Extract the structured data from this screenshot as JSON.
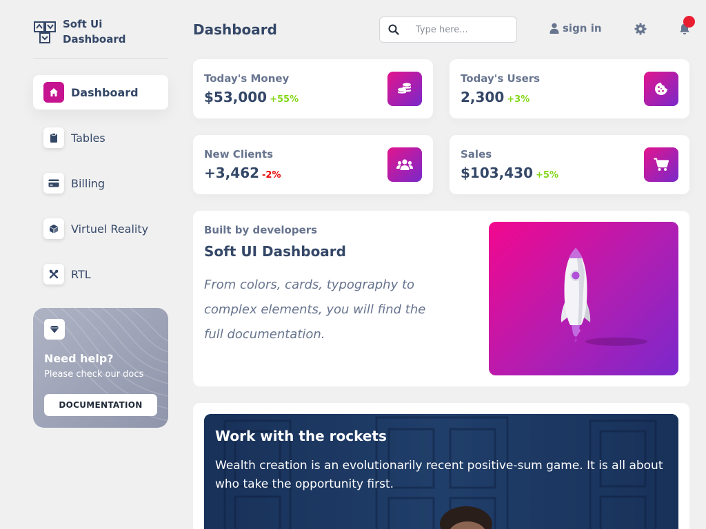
{
  "brand": {
    "name_line1": "Soft Ui",
    "name_line2": "Dashboard"
  },
  "sidebar": {
    "items": [
      {
        "label": "Dashboard",
        "icon": "home-icon",
        "active": true
      },
      {
        "label": "Tables",
        "icon": "clipboard-icon"
      },
      {
        "label": "Billing",
        "icon": "credit-card-icon"
      },
      {
        "label": "Virtuel Reality",
        "icon": "cube-icon"
      },
      {
        "label": "RTL",
        "icon": "tools-icon"
      }
    ],
    "help": {
      "icon": "diamond-icon",
      "title": "Need help?",
      "subtitle": "Please check our docs",
      "button": "DOCUMENTATION"
    }
  },
  "header": {
    "title": "Dashboard",
    "search_placeholder": "Type here...",
    "sign_in": "sign in"
  },
  "stats": [
    {
      "label": "Today's Money",
      "value": "$53,000",
      "change": "+55%",
      "trend": "up",
      "icon": "coins-icon"
    },
    {
      "label": "Today's Users",
      "value": "2,300",
      "change": "+3%",
      "trend": "up",
      "icon": "cookie-icon"
    },
    {
      "label": "New Clients",
      "value": "+3,462",
      "change": "-2%",
      "trend": "down",
      "icon": "users-icon"
    },
    {
      "label": "Sales",
      "value": "$103,430",
      "change": "+5%",
      "trend": "up",
      "icon": "cart-icon"
    }
  ],
  "developers": {
    "eyebrow": "Built by developers",
    "title": "Soft UI Dashboard",
    "description": "From colors, cards, typography to complex elements, you will find the full documentation."
  },
  "rockets": {
    "title": "Work with the rockets",
    "text": "Wealth creation is an evolutionarily recent positive-sum game. It is all about who take the opportunity first."
  },
  "colors": {
    "primary_gradient_start": "#e2158d",
    "primary_gradient_end": "#7928ca",
    "text_dark": "#344767",
    "text_muted": "#67748e",
    "positive": "#82d616",
    "negative": "#ea0606",
    "notification": "#ea1e31"
  }
}
